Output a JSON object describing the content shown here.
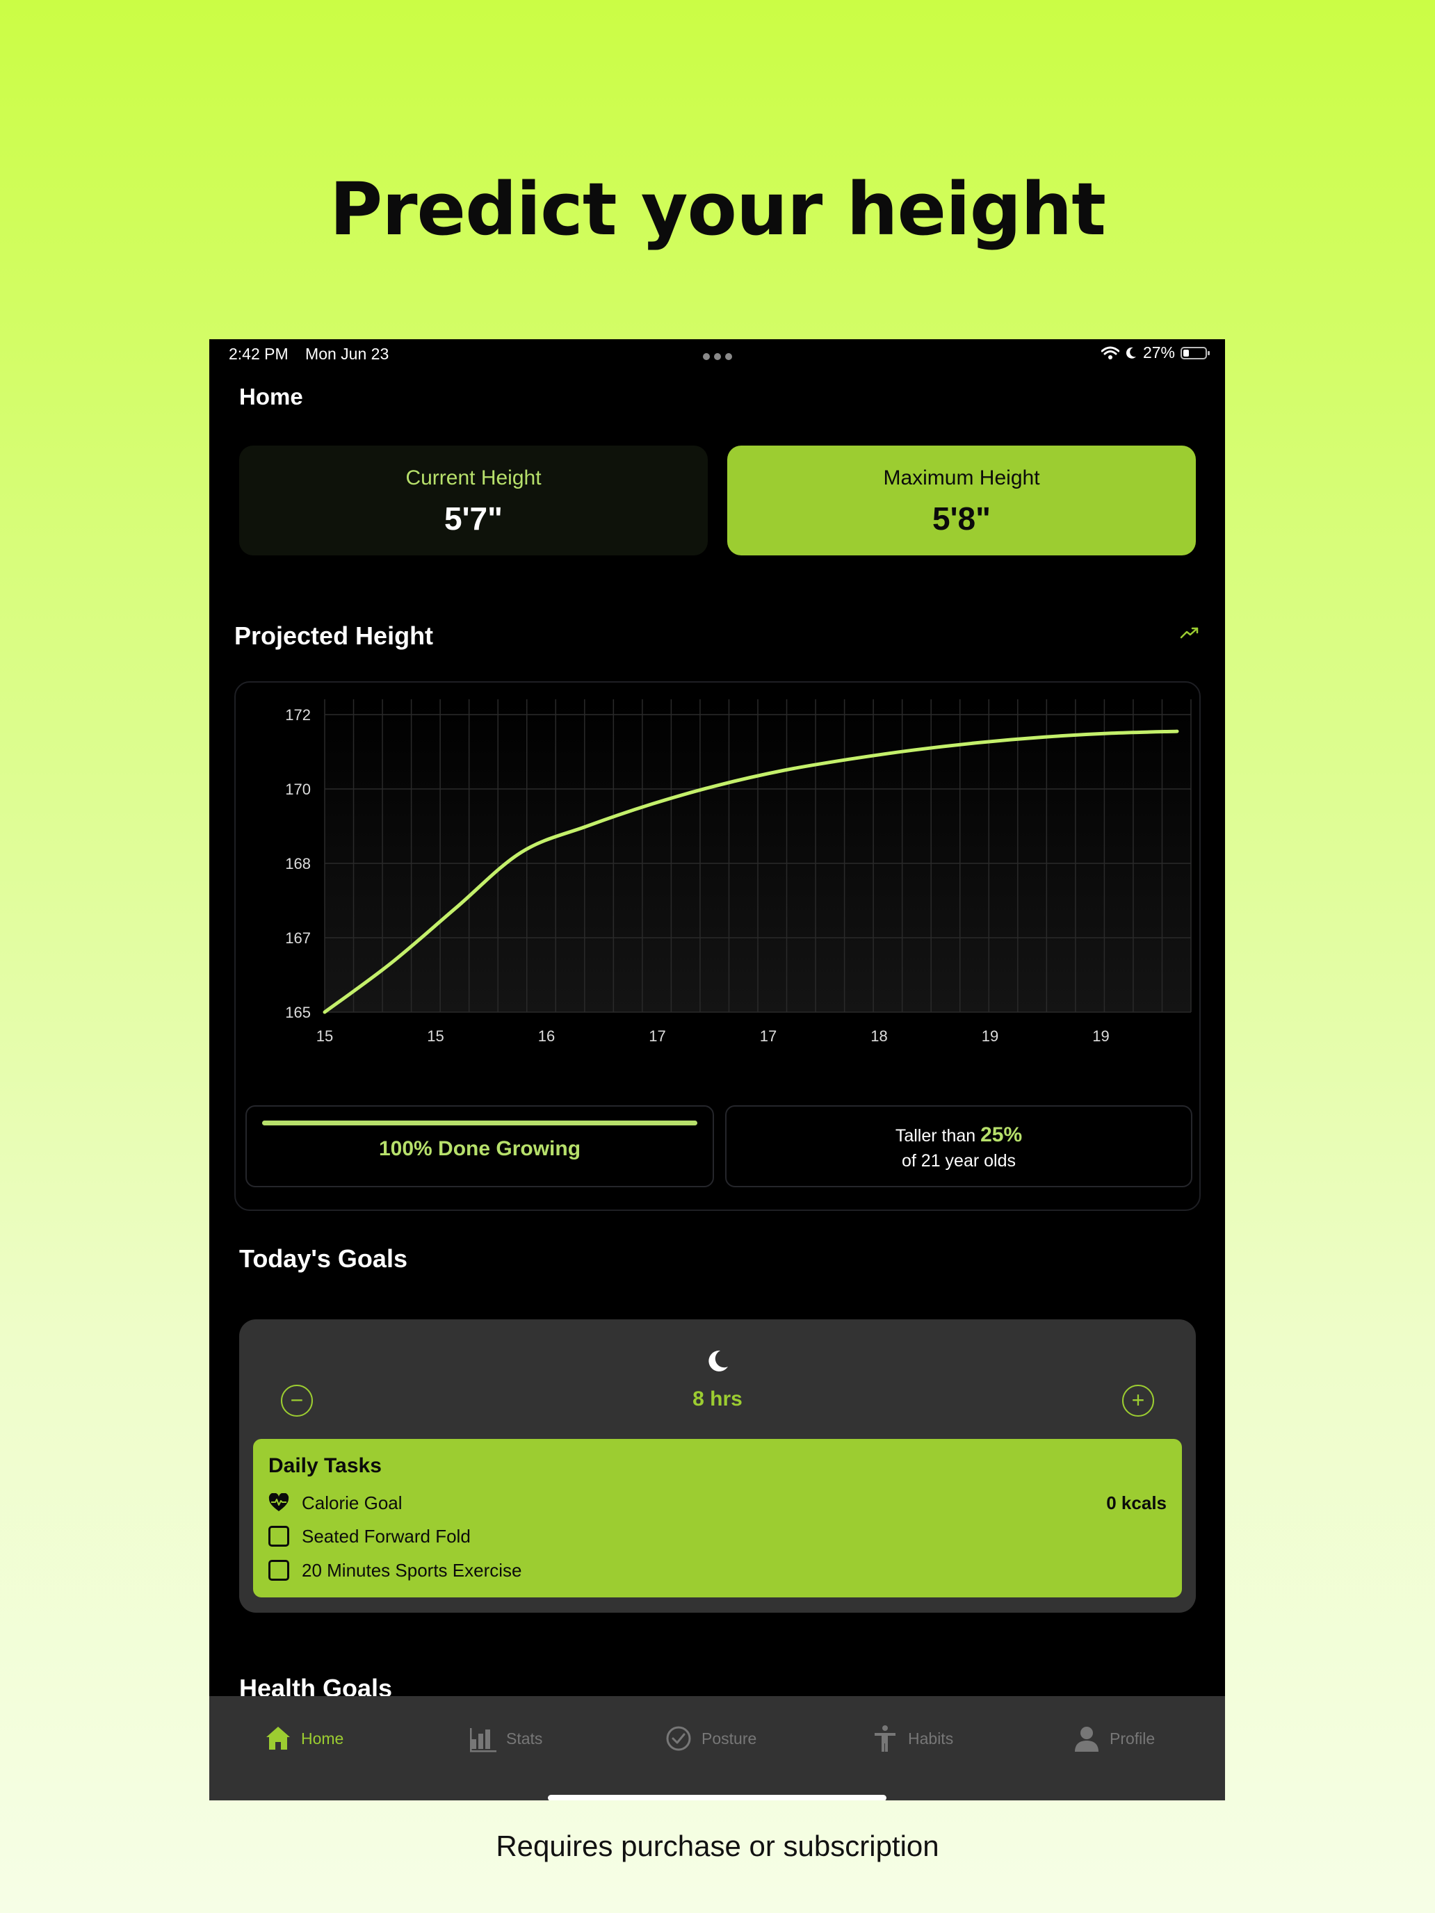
{
  "headline": "Predict your height",
  "footer_note": "Requires purchase or subscription",
  "status_bar": {
    "time": "2:42 PM",
    "date": "Mon Jun 23",
    "battery": "27%",
    "battery_level": 0.27
  },
  "header": {
    "title": "Home"
  },
  "height_cards": {
    "current": {
      "label": "Current Height",
      "value": "5'7\""
    },
    "maximum": {
      "label": "Maximum Height",
      "value": "5'8\""
    }
  },
  "projected": {
    "title": "Projected Height",
    "trend_icon": "trend-up-icon"
  },
  "chart_data": {
    "type": "line",
    "x_tick_labels": [
      "15",
      "15",
      "16",
      "17",
      "17",
      "18",
      "19",
      "19"
    ],
    "y_tick_labels": [
      "165",
      "167",
      "168",
      "170",
      "172"
    ],
    "x": [
      14.9,
      15.3,
      15.7,
      16.1,
      16.5,
      16.9,
      17.3,
      17.7,
      18.1,
      18.5,
      18.9,
      19.3,
      19.7,
      20.1
    ],
    "y": [
      165.0,
      166.3,
      167.4,
      168.3,
      169.0,
      169.6,
      170.1,
      170.5,
      170.8,
      171.05,
      171.25,
      171.4,
      171.5,
      171.55
    ],
    "ylim": [
      165,
      172
    ],
    "grid": true,
    "line_color": "#c4f06b"
  },
  "growth": {
    "label": "100% Done Growing",
    "progress": 1.0
  },
  "percentile": {
    "prefix": "Taller than",
    "value": "25%",
    "suffix": "of 21 year olds"
  },
  "goals": {
    "title": "Today's Goals",
    "sleep": {
      "icon": "moon-icon",
      "value": "8 hrs",
      "minus": "−",
      "plus": "+"
    },
    "tasks": {
      "title": "Daily Tasks",
      "calorie": {
        "label": "Calorie Goal",
        "amount": "0 kcals"
      },
      "items": [
        "Seated Forward Fold",
        "20 Minutes Sports Exercise"
      ]
    }
  },
  "health_goals": {
    "title": "Health Goals"
  },
  "tabs": [
    {
      "label": "Home",
      "icon": "home-icon",
      "active": true
    },
    {
      "label": "Stats",
      "icon": "bar-chart-icon",
      "active": false
    },
    {
      "label": "Posture",
      "icon": "check-circle-icon",
      "active": false
    },
    {
      "label": "Habits",
      "icon": "figure-icon",
      "active": false
    },
    {
      "label": "Profile",
      "icon": "person-icon",
      "active": false
    }
  ],
  "colors": {
    "accent": "#9ccd31",
    "accent_light": "#b7e06b",
    "card_dark": "#333333"
  }
}
